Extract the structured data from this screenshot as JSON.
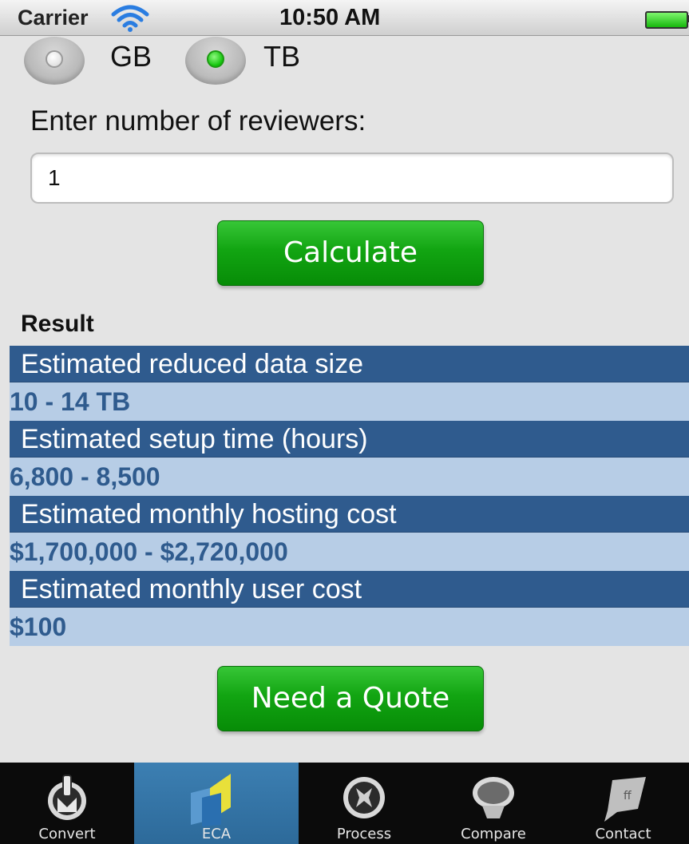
{
  "status_bar": {
    "carrier": "Carrier",
    "time": "10:50 AM"
  },
  "unit_options": [
    {
      "label": "GB",
      "selected": false
    },
    {
      "label": "TB",
      "selected": true
    }
  ],
  "reviewers": {
    "prompt": "Enter number of reviewers:",
    "value": "1"
  },
  "buttons": {
    "calculate": "Calculate",
    "quote": "Need a Quote"
  },
  "result": {
    "title": "Result",
    "rows": [
      {
        "label": "Estimated reduced data size",
        "value": "10 - 14 TB"
      },
      {
        "label": "Estimated setup time (hours)",
        "value": "6,800 - 8,500"
      },
      {
        "label": "Estimated monthly hosting cost",
        "value": "$1,700,000 - $2,720,000"
      },
      {
        "label": "Estimated monthly user cost",
        "value": "$100"
      }
    ]
  },
  "tab_bar": {
    "tabs": [
      {
        "label": "Convert",
        "icon": "power-icon",
        "active": false
      },
      {
        "label": "ECA",
        "icon": "folders-icon",
        "active": true
      },
      {
        "label": "Process",
        "icon": "process-icon",
        "active": false
      },
      {
        "label": "Compare",
        "icon": "compare-icon",
        "active": false
      },
      {
        "label": "Contact",
        "icon": "speech-bubble-icon",
        "active": false
      }
    ]
  },
  "colors": {
    "accent_green": "#12a512",
    "result_header_blue": "#2f5b8e",
    "result_value_bg": "#b7cde6",
    "tab_active": "#3c7fb2"
  }
}
